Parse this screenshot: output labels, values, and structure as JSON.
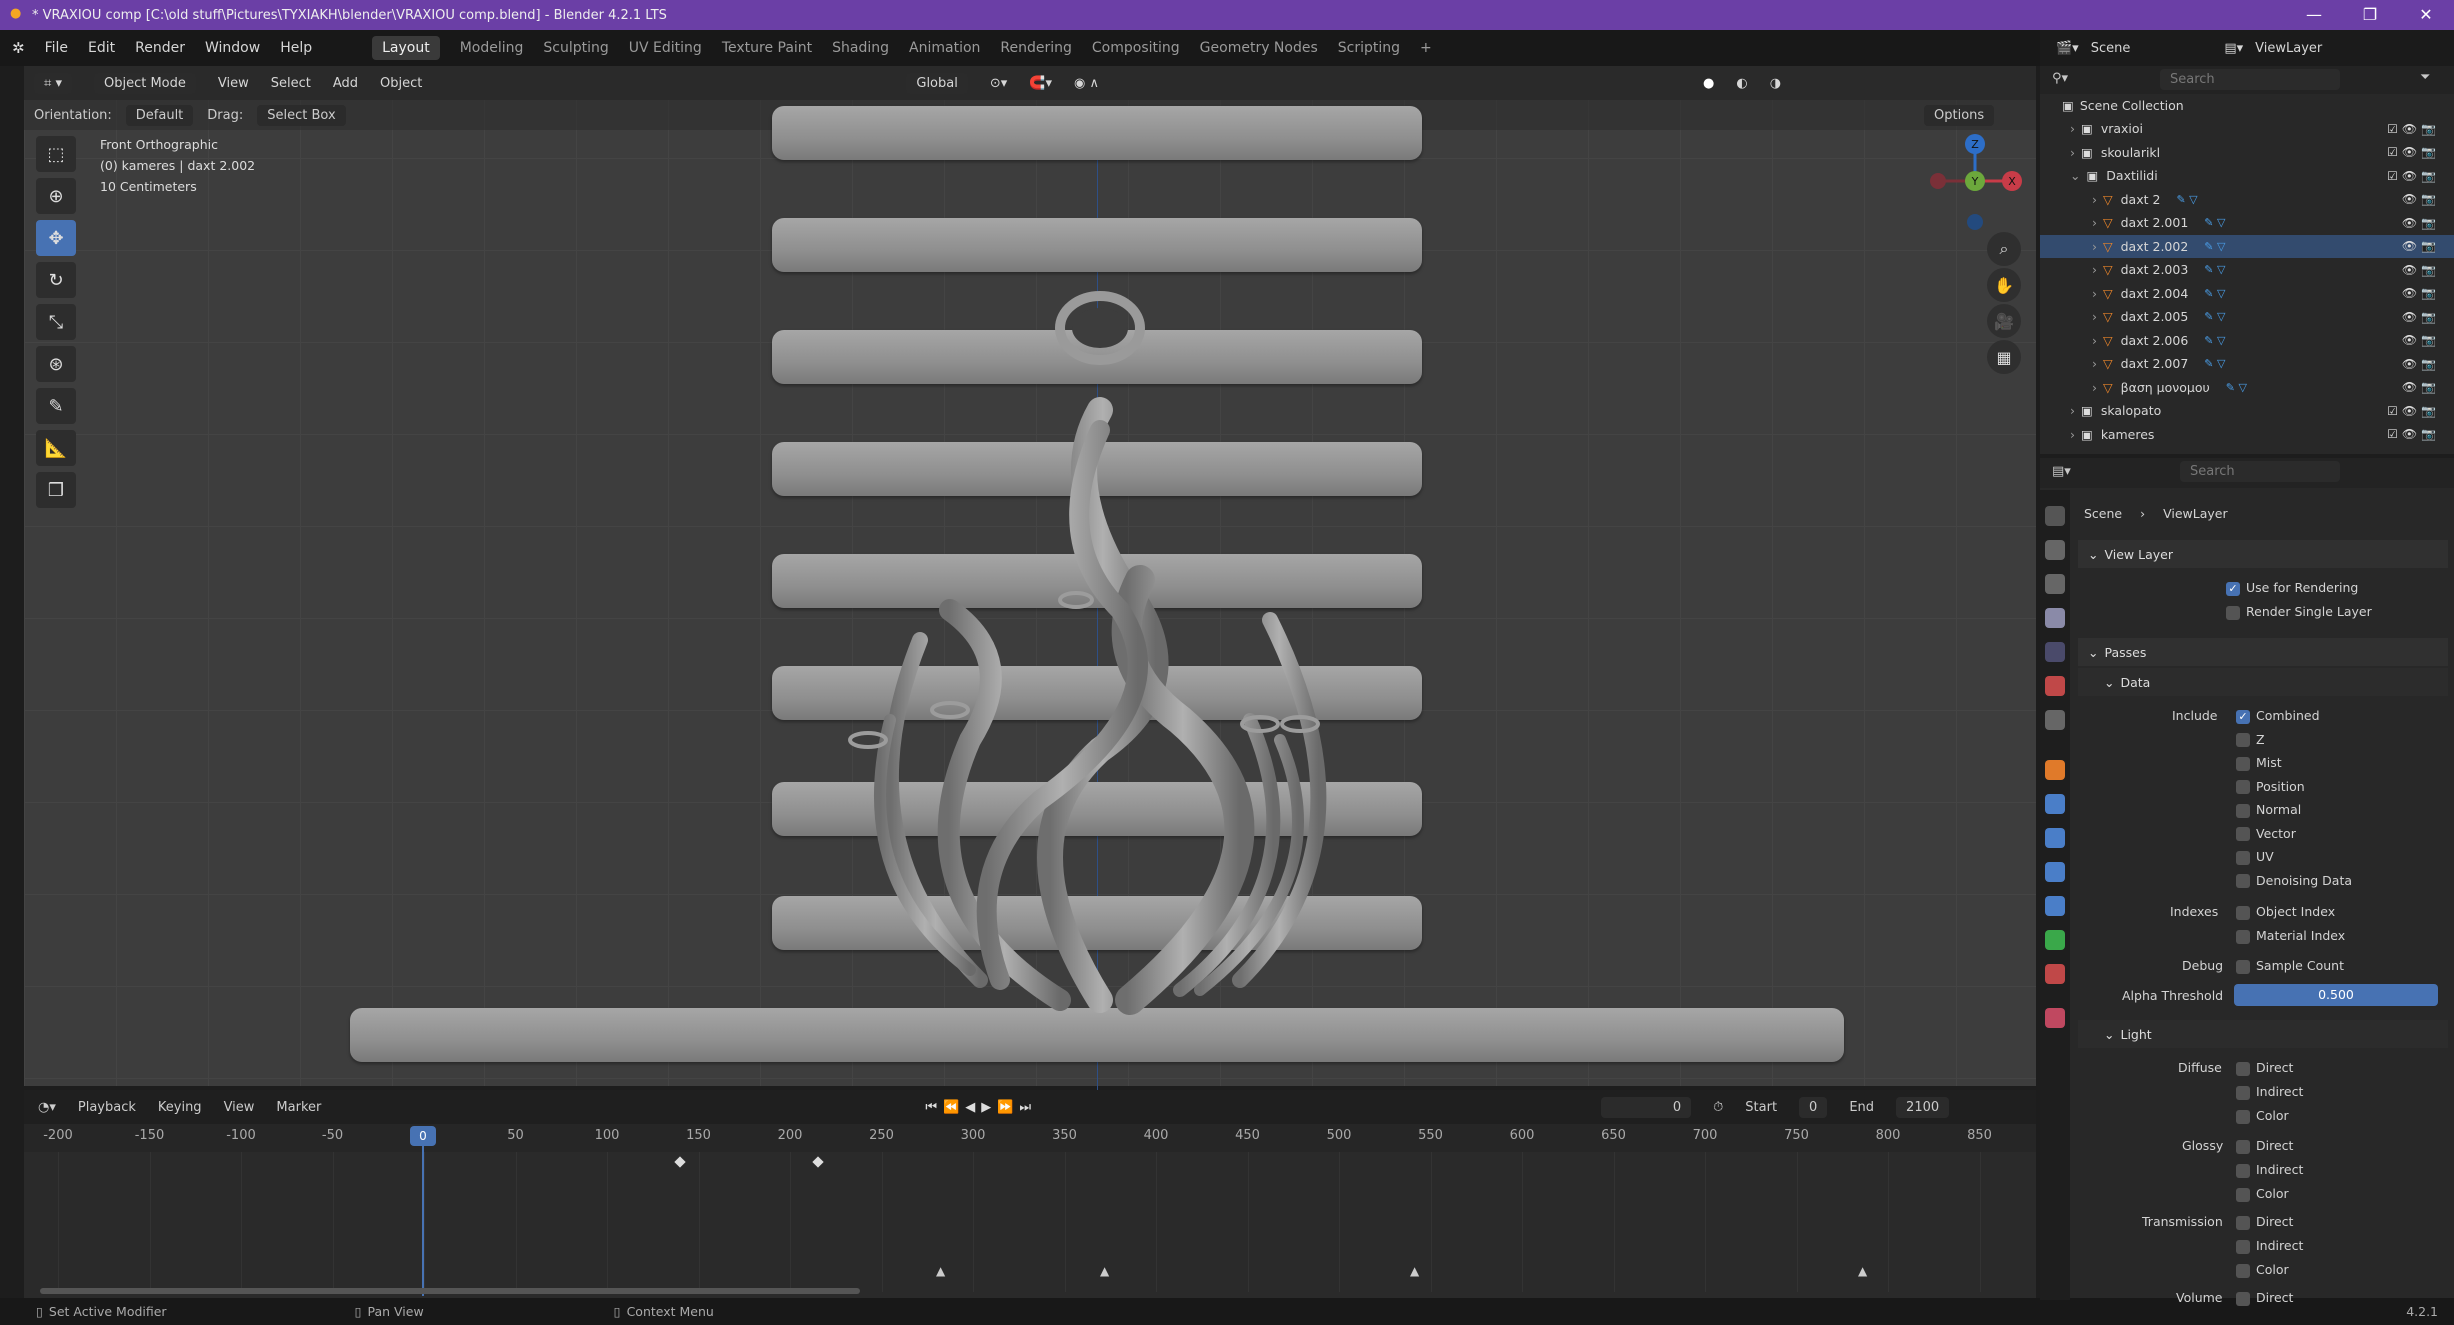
{
  "window": {
    "title": "* VRAXIOU comp [C:\\old stuff\\Pictures\\TYXIAKH\\blender\\VRAXIOU comp.blend] - Blender 4.2.1 LTS",
    "controls": [
      "—",
      "❐",
      "✕"
    ]
  },
  "menu": {
    "items": [
      "File",
      "Edit",
      "Render",
      "Window",
      "Help"
    ],
    "workspaces": [
      "Layout",
      "Modeling",
      "Sculpting",
      "UV Editing",
      "Texture Paint",
      "Shading",
      "Animation",
      "Rendering",
      "Compositing",
      "Geometry Nodes",
      "Scripting",
      "+"
    ]
  },
  "viewport": {
    "mode": "Object Mode",
    "header_menus": [
      "View",
      "Select",
      "Add",
      "Object"
    ],
    "orientation_label": "Orientation:",
    "orientation_value": "Default",
    "drag_label": "Drag:",
    "drag_value": "Select Box",
    "transform": "Global",
    "options": "Options",
    "info": [
      "Front Orthographic",
      "(0) kameres | daxt 2.002",
      "10 Centimeters"
    ],
    "gizmo": {
      "z": "Z",
      "y": "Y",
      "x": "X"
    }
  },
  "timeline": {
    "menus": [
      "Playback",
      "Keying",
      "View",
      "Marker"
    ],
    "current_frame": "0",
    "start_label": "Start",
    "start": "0",
    "end_label": "End",
    "end": "2100",
    "ticks": [
      "-200",
      "-150",
      "-100",
      "-50",
      "0",
      "50",
      "100",
      "150",
      "200",
      "250",
      "300",
      "350",
      "400",
      "450",
      "500",
      "550",
      "600",
      "650",
      "700",
      "750",
      "800",
      "850"
    ]
  },
  "statusbar": {
    "left": "Set Active Modifier",
    "middle": "Pan View",
    "right": "Context Menu",
    "version": "4.2.1"
  },
  "outliner": {
    "scene_label": "Scene",
    "viewlayer_label": "ViewLayer",
    "search_placeholder": "Search",
    "collection": "Scene Collection",
    "rows": [
      {
        "label": "vraxioi",
        "indent": 1
      },
      {
        "label": "skoularikl",
        "indent": 1
      },
      {
        "label": "Daxtilidi",
        "indent": 1
      },
      {
        "label": "daxt 2",
        "indent": 2
      },
      {
        "label": "daxt 2.001",
        "indent": 2
      },
      {
        "label": "daxt 2.002",
        "indent": 2
      },
      {
        "label": "daxt 2.003",
        "indent": 2
      },
      {
        "label": "daxt 2.004",
        "indent": 2
      },
      {
        "label": "daxt 2.005",
        "indent": 2
      },
      {
        "label": "daxt 2.006",
        "indent": 2
      },
      {
        "label": "daxt 2.007",
        "indent": 2
      },
      {
        "label": "βαση μονομου",
        "indent": 2
      },
      {
        "label": "skalopato",
        "indent": 1
      },
      {
        "label": "kameres",
        "indent": 1
      }
    ]
  },
  "properties": {
    "search_placeholder": "Search",
    "breadcrumb": [
      "Scene",
      "ViewLayer"
    ],
    "view_layer_title": "View Layer",
    "use_for_rendering": "Use for Rendering",
    "render_single_layer": "Render Single Layer",
    "passes_title": "Passes",
    "data_title": "Data",
    "include_label": "Include",
    "include_items": [
      "Combined",
      "Z",
      "Mist",
      "Position",
      "Normal",
      "Vector",
      "UV",
      "Denoising Data"
    ],
    "indexes_label": "Indexes",
    "indexes_items": [
      "Object Index",
      "Material Index"
    ],
    "debug_label": "Debug",
    "debug_item": "Sample Count",
    "alpha_label": "Alpha Threshold",
    "alpha_value": "0.500",
    "light_title": "Light",
    "diffuse_label": "Diffuse",
    "glossy_label": "Glossy",
    "transmission_label": "Transmission",
    "volume_label": "Volume",
    "light_items": [
      "Direct",
      "Indirect",
      "Color"
    ],
    "volume_item": "Direct"
  }
}
